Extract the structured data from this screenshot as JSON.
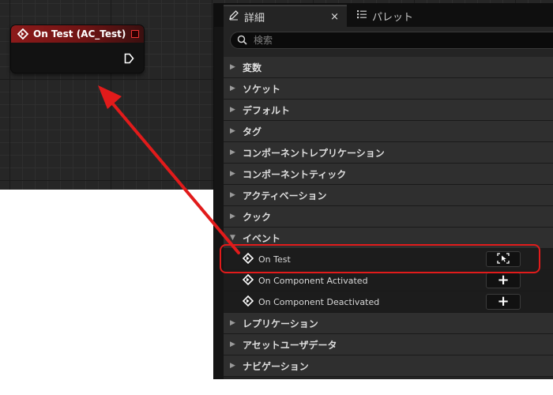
{
  "graph_node": {
    "title": "On Test (AC_Test)"
  },
  "details_panel": {
    "tabs": [
      {
        "label": "詳細",
        "icon": "pencil-icon"
      },
      {
        "label": "パレット",
        "icon": "list-icon"
      }
    ],
    "close_label": "×",
    "search": {
      "placeholder": "検索",
      "value": ""
    },
    "categories": [
      "変数",
      "ソケット",
      "デフォルト",
      "タグ",
      "コンポーネントレプリケーション",
      "コンポーネントティック",
      "アクティベーション",
      "クック"
    ],
    "event_category": "イベント",
    "events": [
      {
        "label": "On Test",
        "button": "go-to-node-icon"
      },
      {
        "label": "On Component Activated",
        "button": "+"
      },
      {
        "label": "On Component Deactivated",
        "button": "+"
      }
    ],
    "categories_after": [
      "レプリケーション",
      "アセットユーザデータ",
      "ナビゲーション"
    ]
  },
  "colors": {
    "accent_red": "#e11b1b",
    "node_header": "#8c1a1a",
    "panel_bg": "#242424"
  }
}
